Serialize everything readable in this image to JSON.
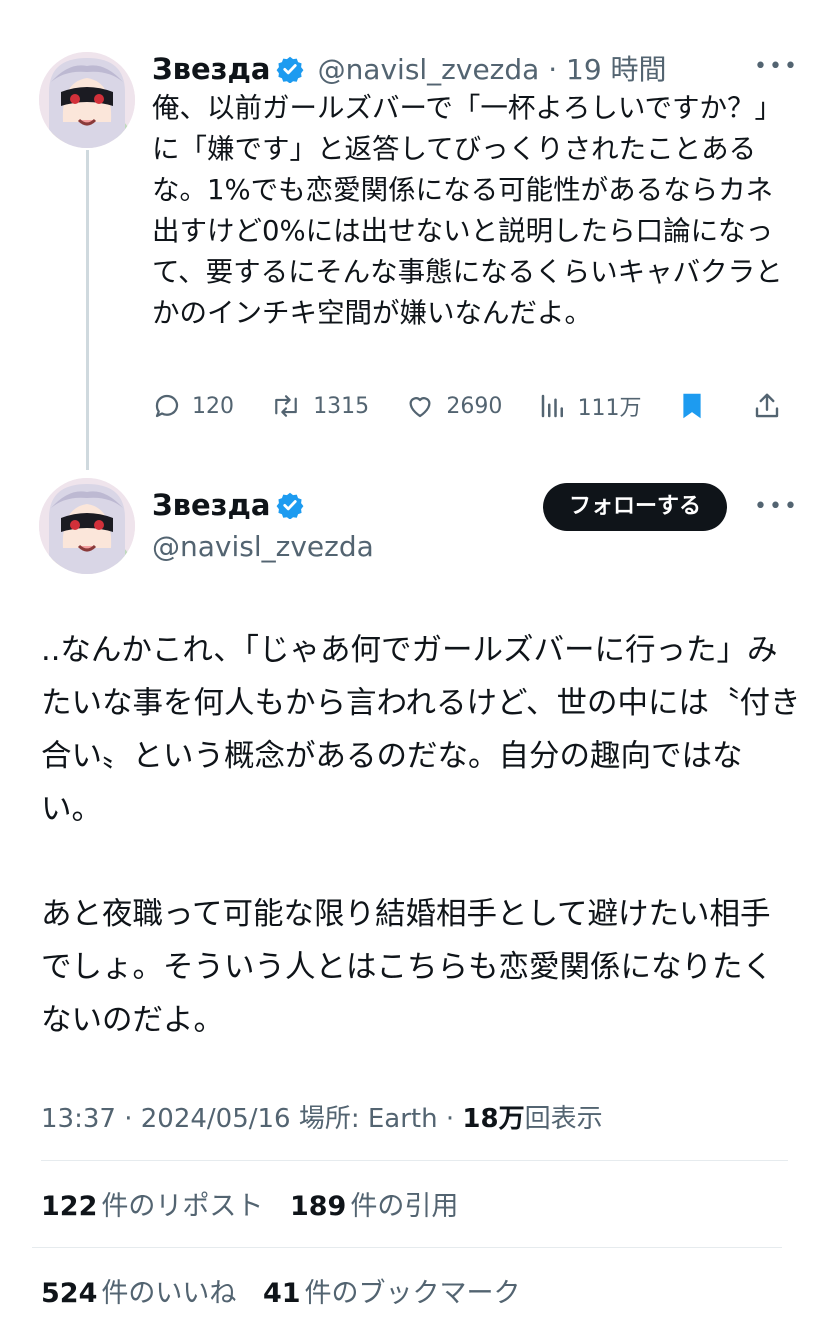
{
  "quoted_tweet": {
    "display_name": "Звезда",
    "handle": "@navisl_zvezda",
    "time_ago": "19 時間",
    "text": "俺、以前ガールズバーで「一杯よろしいですか？」に「嫌です」と返答してびっくりされたことあるな。1%でも恋愛関係になる可能性があるならカネ出すけど0%には出せないと説明したら口論になって、要するにそんな事態になるくらいキャバクラとかのインチキ空間が嫌いなんだよ。",
    "replies": "120",
    "reposts": "1315",
    "likes": "2690",
    "views": "111万"
  },
  "main_tweet": {
    "display_name": "Звезда",
    "handle": "@navisl_zvezda",
    "follow_label": "フォローする",
    "paragraph1": "..なんかこれ、「じゃあ何でガールズバーに行った」みたいな事を何人もから言われるけど、世の中には〝付き合い〟という概念があるのだな。自分の趣向ではない。",
    "paragraph2": "あと夜職って可能な限り結婚相手として避けたい相手でしょ。そういう人とはこちらも恋愛関係になりたくないのだよ。",
    "time": "13:37",
    "date": "2024/05/16",
    "location_label": "場所: Earth",
    "views_count": "18万",
    "views_label": "回表示",
    "repost_count": "122",
    "repost_label": "件のリポスト",
    "quote_count": "189",
    "quote_label": "件の引用",
    "like_count": "524",
    "like_label": "件のいいね",
    "bookmark_count": "41",
    "bookmark_label": "件のブックマーク"
  },
  "colors": {
    "verified": "#1d9bf0",
    "bookmark_active": "#1d9bf0",
    "muted": "#536471",
    "text": "#0f1419",
    "follow_bg": "#0f1419"
  },
  "icons": {
    "more": "more-dots-icon",
    "reply": "reply-bubble-icon",
    "repost": "repost-arrows-icon",
    "like": "heart-icon",
    "views": "bar-chart-icon",
    "bookmark": "bookmark-filled-icon",
    "share": "share-upload-icon",
    "verified": "verified-badge-icon"
  }
}
